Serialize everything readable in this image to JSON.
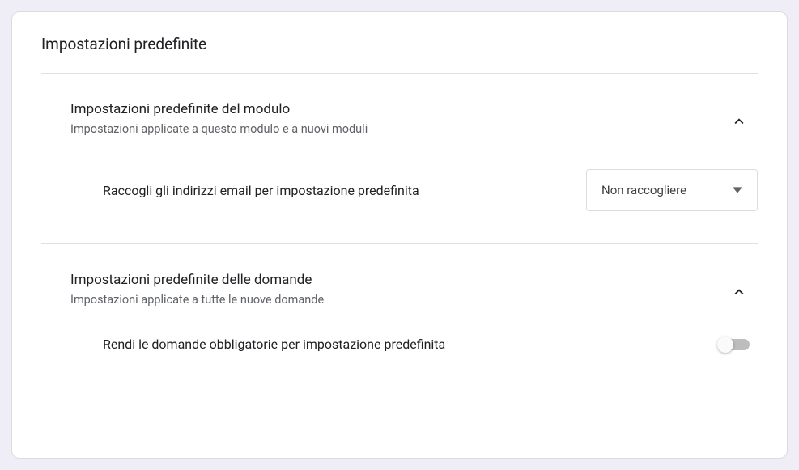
{
  "heading": "Impostazioni predefinite",
  "sections": [
    {
      "title": "Impostazioni predefinite del modulo",
      "subtitle": "Impostazioni applicate a questo modulo e a nuovi moduli",
      "row": {
        "label": "Raccogli gli indirizzi email per impostazione predefinita",
        "selected": "Non raccogliere"
      }
    },
    {
      "title": "Impostazioni predefinite delle domande",
      "subtitle": "Impostazioni applicate a tutte le nuove domande",
      "row": {
        "label": "Rendi le domande obbligatorie per impostazione predefinita",
        "toggle_on": false
      }
    }
  ]
}
